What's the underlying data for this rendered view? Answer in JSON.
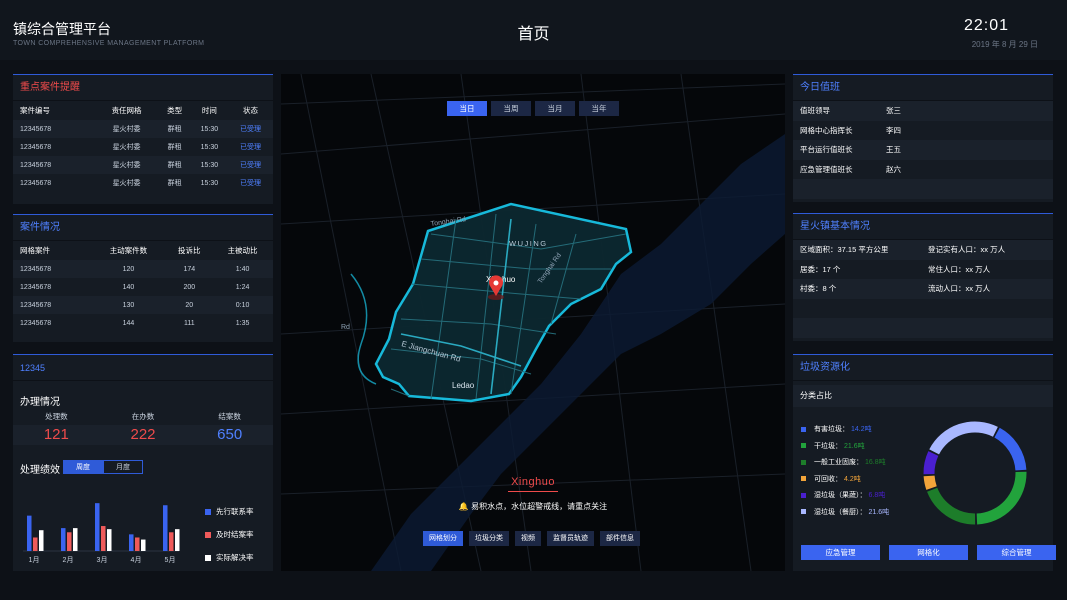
{
  "header": {
    "title": "镇综合管理平台",
    "subtitle": "TOWN COMPREHENSIVE MANAGEMENT PLATFORM",
    "page_title": "首页",
    "time": "22:01",
    "date": "2019 年 8 月 29 日"
  },
  "alerts": {
    "title": "重点案件提醒",
    "headers": [
      "案件编号",
      "责任网格",
      "类型",
      "时间",
      "状态"
    ],
    "rows": [
      [
        "12345678",
        "星火村委",
        "群租",
        "15:30",
        "已受理"
      ],
      [
        "12345678",
        "星火村委",
        "群租",
        "15:30",
        "已受理"
      ],
      [
        "12345678",
        "星火村委",
        "群租",
        "15:30",
        "已受理"
      ],
      [
        "12345678",
        "星火村委",
        "群租",
        "15:30",
        "已受理"
      ]
    ]
  },
  "cases": {
    "title": "案件情况",
    "headers": [
      "网格案件",
      "主动案件数",
      "投诉比",
      "主被动比"
    ],
    "rows": [
      [
        "12345678",
        "120",
        "174",
        "1:40"
      ],
      [
        "12345678",
        "140",
        "200",
        "1:24"
      ],
      [
        "12345678",
        "130",
        "20",
        "0:10"
      ],
      [
        "12345678",
        "144",
        "111",
        "1:35"
      ]
    ]
  },
  "hotline": {
    "title": "12345",
    "handling_title": "办理情况",
    "stats": [
      {
        "label": "处理数",
        "value": "121"
      },
      {
        "label": "在办数",
        "value": "222"
      },
      {
        "label": "结案数",
        "value": "650"
      }
    ],
    "performance_title": "处理绩效",
    "perf_tabs": [
      "周度",
      "月度"
    ],
    "perf_active_tab": "周度"
  },
  "chart_data": {
    "type": "bar",
    "categories": [
      "1月",
      "2月",
      "3月",
      "4月",
      "5月"
    ],
    "series": [
      {
        "name": "先行联系率",
        "color": "#3a64f0",
        "values": [
          34,
          22,
          46,
          16,
          44
        ]
      },
      {
        "name": "及时结案率",
        "color": "#ef5a5a",
        "values": [
          13,
          18,
          24,
          13,
          18
        ]
      },
      {
        "name": "实际解决率",
        "color": "#ffffff",
        "values": [
          20,
          22,
          21,
          11,
          21
        ]
      }
    ],
    "title": "",
    "xlabel": "",
    "ylabel": "",
    "ylim": [
      0,
      50
    ],
    "grid": false,
    "legend": "right"
  },
  "map": {
    "time_tabs": [
      "当日",
      "当周",
      "当月",
      "当年"
    ],
    "active_time_tab": "当日",
    "labels": {
      "road_1": "Tonghai Rd",
      "road_2": "Tonghai Rd",
      "district_1": "WUJING",
      "town": "Xinghuo",
      "road_3": "E Jiangchuan Rd",
      "district_2": "Ledao",
      "road_4": "Rd"
    },
    "caption": "Xinghuo",
    "alert_text": "易积水点，水位超警戒线，请重点关注",
    "bottom_buttons": [
      "网格划分",
      "垃圾分类",
      "视频",
      "监督员轨迹",
      "部件信息"
    ],
    "active_bottom_button": "网格划分",
    "accent_color": "#19c3e6"
  },
  "duty": {
    "title": "今日值班",
    "rows": [
      {
        "role": "值班领导",
        "name": "张三"
      },
      {
        "role": "网格中心指挥长",
        "name": "李四"
      },
      {
        "role": "平台运行值班长",
        "name": "王五"
      },
      {
        "role": "应急管理值班长",
        "name": "赵六"
      }
    ]
  },
  "town": {
    "title": "星火镇基本情况",
    "rows": [
      [
        "区域面积：37.15 平方公里",
        "登记实有人口：xx 万人"
      ],
      [
        "居委：17 个",
        "常住人口：xx 万人"
      ],
      [
        "村委：8 个",
        "流动人口：xx 万人"
      ]
    ]
  },
  "waste": {
    "title": "垃圾资源化",
    "subtitle": "分类占比",
    "items": [
      {
        "label": "有害垃圾：",
        "value": "14.2吨",
        "color": "#3a64f0",
        "share": 14.2
      },
      {
        "label": "干垃圾：",
        "value": "21.6吨",
        "color": "#22a33c",
        "share": 21.6
      },
      {
        "label": "一般工业固废：",
        "value": "16.8吨",
        "color": "#1d7d2a",
        "share": 16.8
      },
      {
        "label": "可回收：",
        "value": "4.2吨",
        "color": "#f2a43a",
        "share": 4.2
      },
      {
        "label": "湿垃圾（果蔬）：",
        "value": "6.8吨",
        "color": "#4a1fd0",
        "share": 6.8
      },
      {
        "label": "湿垃圾（餐厨）：",
        "value": "21.6吨",
        "color": "#a9b8ff",
        "share": 21.6
      }
    ],
    "buttons": [
      "应急管理",
      "网格化",
      "综合管理"
    ]
  }
}
